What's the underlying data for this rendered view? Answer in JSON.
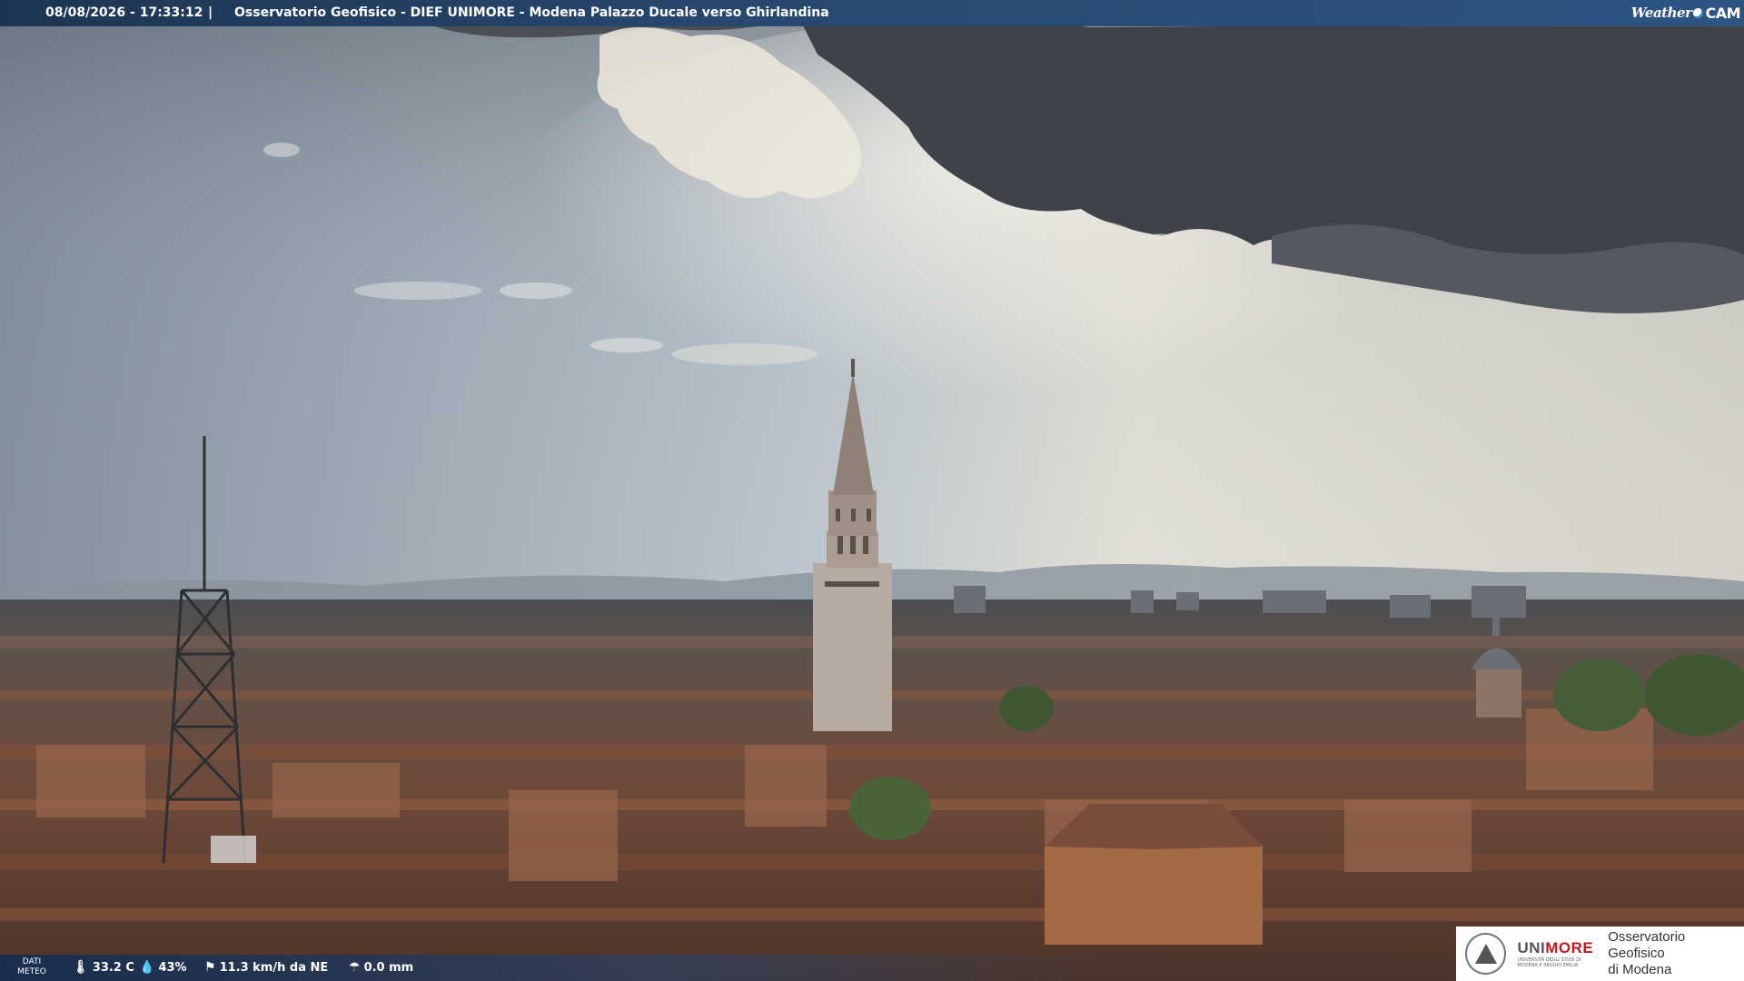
{
  "overlay": {
    "datetime": "08/08/2026 - 17:33:12",
    "separator": "|",
    "title": "Osservatorio Geofisico - DIEF UNIMORE - Modena Palazzo Ducale verso Ghirlandina",
    "brand_left": "Weather",
    "brand_right": "CAM"
  },
  "weather": {
    "label_line1": "DATI",
    "label_line2": "METEO",
    "temperature": "33.2 C",
    "humidity": "43%",
    "wind": "11.3 km/h da NE",
    "rain": "0.0 mm",
    "icons": [
      "thermometer-icon",
      "humidity-drop-icon",
      "wind-sock-icon",
      "rain-gauge-icon"
    ]
  },
  "logo": {
    "university": "UNI",
    "university_accent": "MORE",
    "university_sub1": "UNIVERSITÀ DEGLI STUDI DI",
    "university_sub2": "MODENA E REGGIO EMILIA",
    "observatory_line1": "Osservatorio Geofisico",
    "observatory_line2": "di Modena"
  },
  "colors": {
    "topbar": "#27476e",
    "accent_red": "#c4161c",
    "sky_light": "#e9e6dc",
    "cloud_dark": "#3d4046",
    "roofs": "#7a4a36"
  }
}
